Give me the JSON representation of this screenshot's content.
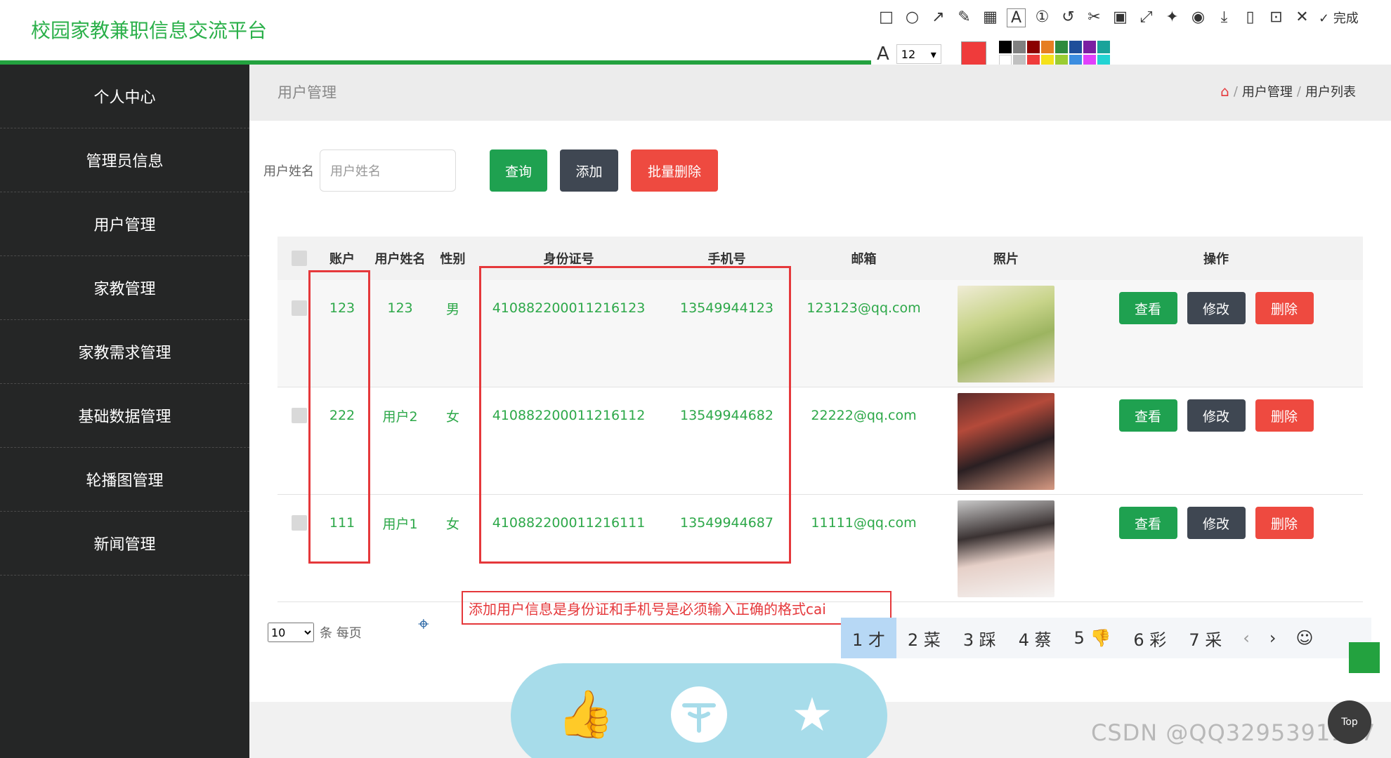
{
  "app": {
    "title": "校园家教兼职信息交流平台"
  },
  "sidebar": {
    "items": [
      {
        "label": "个人中心"
      },
      {
        "label": "管理员信息"
      },
      {
        "label": "用户管理"
      },
      {
        "label": "家教管理"
      },
      {
        "label": "家教需求管理"
      },
      {
        "label": "基础数据管理"
      },
      {
        "label": "轮播图管理"
      },
      {
        "label": "新闻管理"
      }
    ]
  },
  "page": {
    "title": "用户管理",
    "breadcrumb": [
      "用户管理",
      "用户列表"
    ]
  },
  "search": {
    "label": "用户姓名",
    "placeholder": "用户姓名",
    "query_btn": "查询",
    "add_btn": "添加",
    "batch_delete_btn": "批量删除"
  },
  "table": {
    "headers": [
      "账户",
      "用户姓名",
      "性别",
      "身份证号",
      "手机号",
      "邮箱",
      "照片",
      "操作"
    ],
    "rows": [
      {
        "account": "123",
        "name": "123",
        "gender": "男",
        "id_no": "410882200011216123",
        "phone": "13549944123",
        "email": "123123@qq.com"
      },
      {
        "account": "222",
        "name": "用户2",
        "gender": "女",
        "id_no": "410882200011216112",
        "phone": "13549944682",
        "email": "22222@qq.com"
      },
      {
        "account": "111",
        "name": "用户1",
        "gender": "女",
        "id_no": "410882200011216111",
        "phone": "13549944687",
        "email": "11111@qq.com"
      }
    ],
    "actions": {
      "view": "查看",
      "edit": "修改",
      "delete": "删除"
    }
  },
  "pager": {
    "page_size": "10",
    "per_page_label": "条 每页"
  },
  "annotation": {
    "text": "添加用户信息是身份证和手机号是必须输入正确的格式cai"
  },
  "ime": {
    "candidates": [
      "1 才",
      "2 菜",
      "3 踩",
      "4 蔡",
      "5 👎",
      "6 彩",
      "7 采"
    ],
    "prev": "‹",
    "next": "›",
    "emoji": "☺"
  },
  "snip_toolbar": {
    "done_label": "完成",
    "font_size": "12"
  },
  "misc": {
    "top_label": "Top",
    "watermark": "CSDN @QQ3295391197"
  },
  "colors": {
    "brand": "#2bb04a",
    "sidebar_bg": "#252626",
    "green_btn": "#1fa150",
    "dark_btn": "#3f4752",
    "red_btn": "#ee4a40",
    "annotation_red": "#e5383b"
  }
}
